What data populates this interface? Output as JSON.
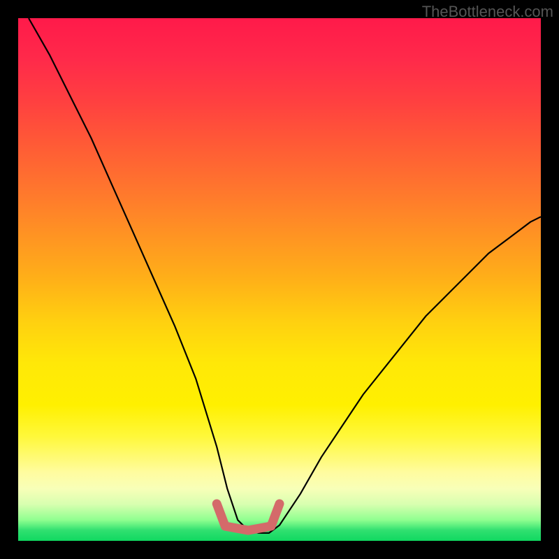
{
  "watermark": "TheBottleneck.com",
  "chart_data": {
    "type": "line",
    "title": "",
    "xlabel": "",
    "ylabel": "",
    "xlim": [
      0,
      100
    ],
    "ylim": [
      0,
      100
    ],
    "note": "V-shaped bottleneck curve over rainbow gradient; minimum plateau highlighted near baseline between x≈40 and x≈50; curve starts top-left, dips to near 0, rises to right ~60% height.",
    "series": [
      {
        "name": "bottleneck-curve",
        "color": "#000000",
        "x": [
          2,
          6,
          10,
          14,
          18,
          22,
          26,
          30,
          34,
          38,
          40,
          42,
          44,
          46,
          48,
          50,
          54,
          58,
          62,
          66,
          70,
          74,
          78,
          82,
          86,
          90,
          94,
          98,
          100
        ],
        "y": [
          100,
          93,
          85,
          77,
          68,
          59,
          50,
          41,
          31,
          18,
          10,
          4,
          2,
          1.5,
          1.5,
          3,
          9,
          16,
          22,
          28,
          33,
          38,
          43,
          47,
          51,
          55,
          58,
          61,
          62
        ]
      }
    ],
    "highlight": {
      "name": "optimal-range",
      "color": "#d46a6a",
      "x_start": 38,
      "x_end": 50,
      "y_level": 2
    },
    "background_gradient": {
      "top": "#ff1a4a",
      "mid": "#fff000",
      "bottom": "#10d860"
    }
  }
}
